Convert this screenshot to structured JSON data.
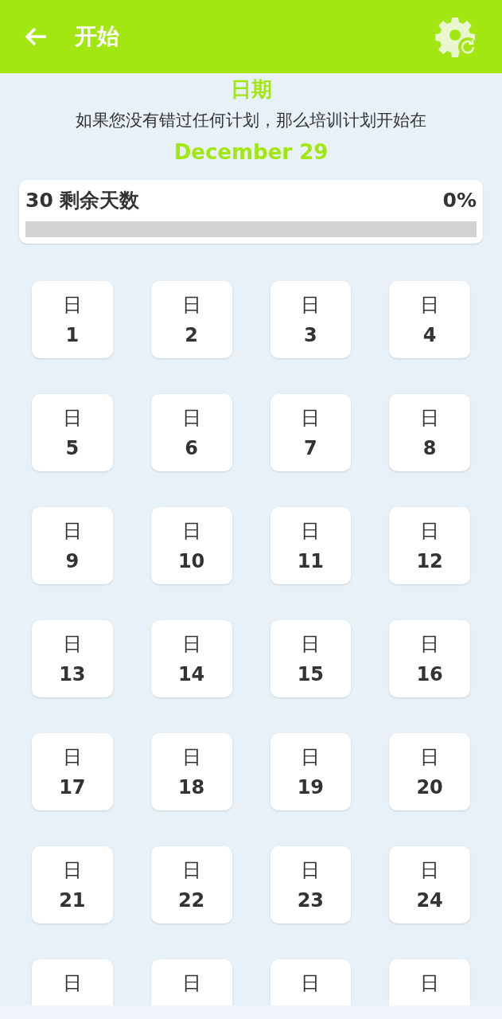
{
  "header": {
    "title": "开始"
  },
  "intro": {
    "heading": "日期",
    "sentence": "如果您没有错过任何计划，那么培训计划开始在",
    "date": "December 29"
  },
  "progress": {
    "remaining": "30 剩余天数",
    "percent": "0%",
    "level": 0
  },
  "days": [
    {
      "label": "日",
      "number": "1"
    },
    {
      "label": "日",
      "number": "2"
    },
    {
      "label": "日",
      "number": "3"
    },
    {
      "label": "日",
      "number": "4"
    },
    {
      "label": "日",
      "number": "5"
    },
    {
      "label": "日",
      "number": "6"
    },
    {
      "label": "日",
      "number": "7"
    },
    {
      "label": "日",
      "number": "8"
    },
    {
      "label": "日",
      "number": "9"
    },
    {
      "label": "日",
      "number": "10"
    },
    {
      "label": "日",
      "number": "11"
    },
    {
      "label": "日",
      "number": "12"
    },
    {
      "label": "日",
      "number": "13"
    },
    {
      "label": "日",
      "number": "14"
    },
    {
      "label": "日",
      "number": "15"
    },
    {
      "label": "日",
      "number": "16"
    },
    {
      "label": "日",
      "number": "17"
    },
    {
      "label": "日",
      "number": "18"
    },
    {
      "label": "日",
      "number": "19"
    },
    {
      "label": "日",
      "number": "20"
    },
    {
      "label": "日",
      "number": "21"
    },
    {
      "label": "日",
      "number": "22"
    },
    {
      "label": "日",
      "number": "23"
    },
    {
      "label": "日",
      "number": "24"
    },
    {
      "label": "日"
    },
    {
      "label": "日"
    },
    {
      "label": "日"
    },
    {
      "label": "日"
    }
  ]
}
